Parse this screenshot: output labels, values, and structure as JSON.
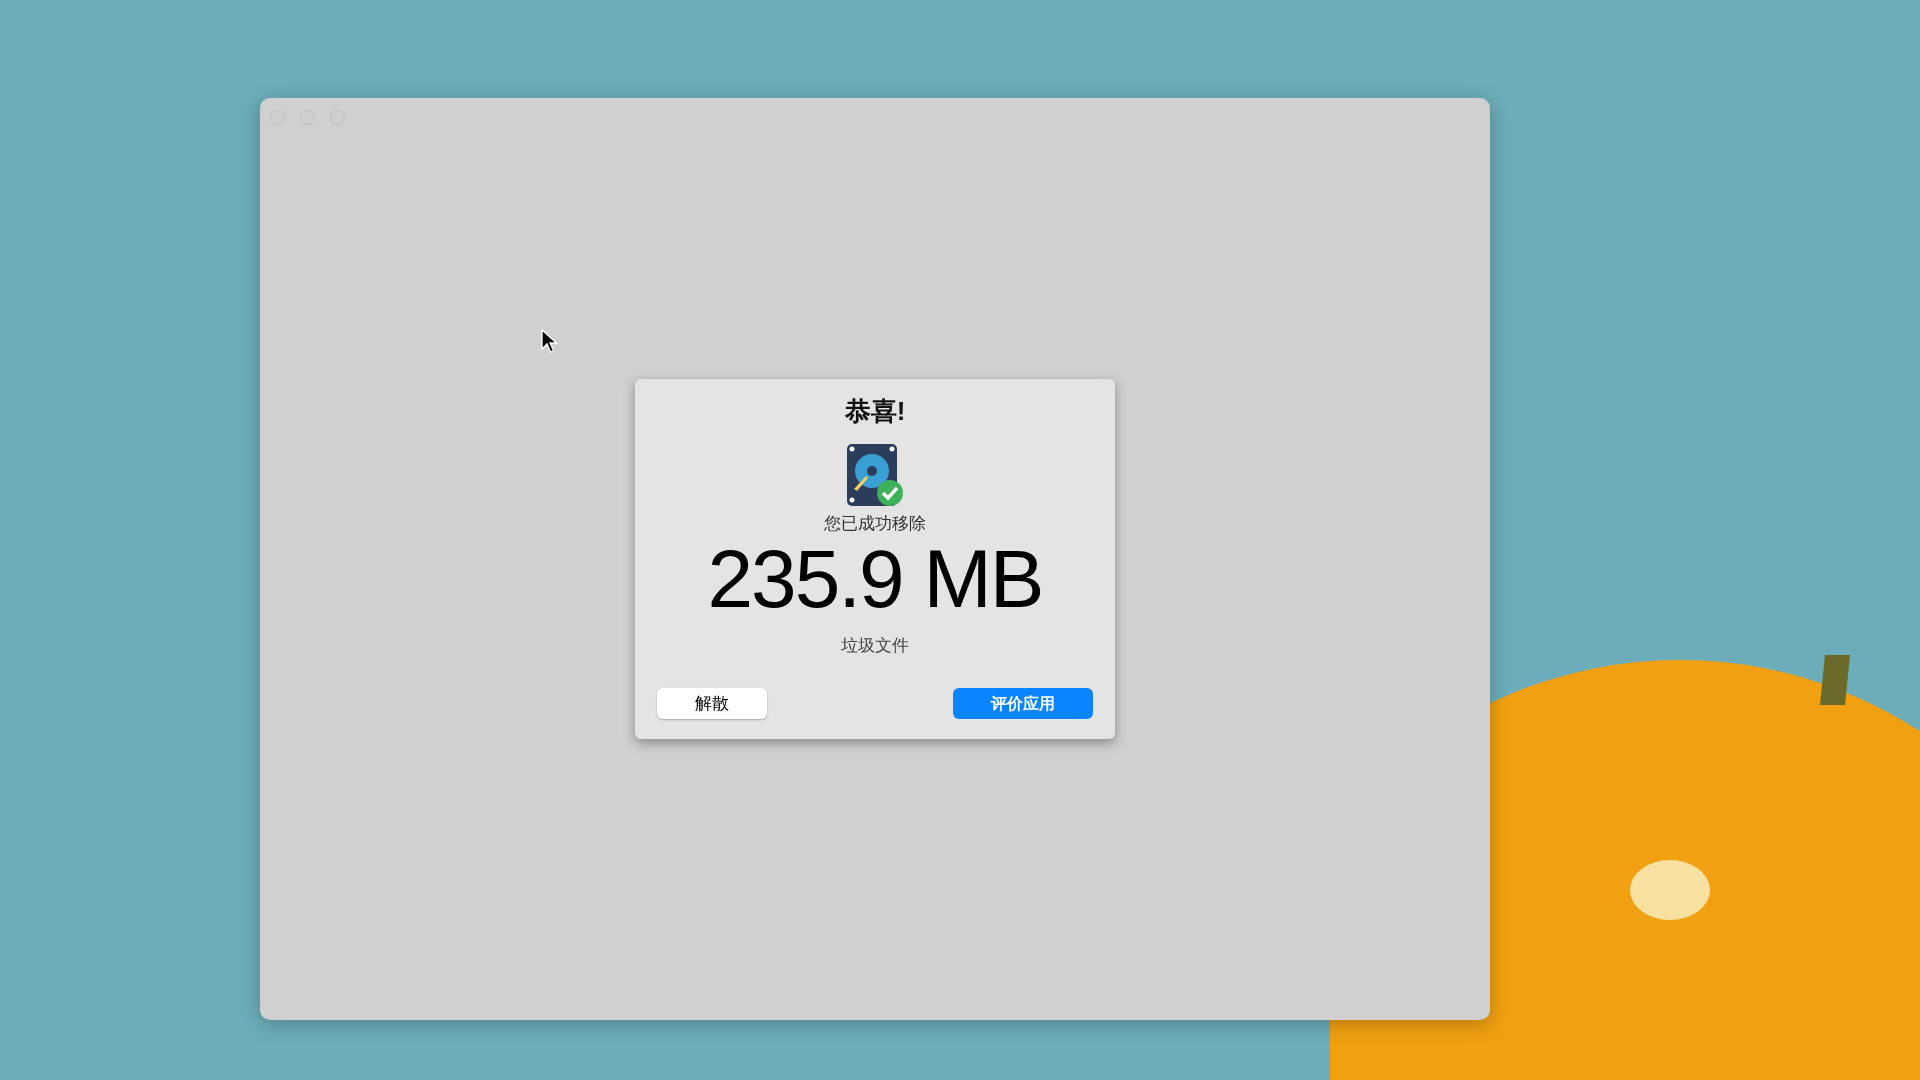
{
  "window": {
    "traffic_lights_disabled": true
  },
  "dialog": {
    "title": "恭喜!",
    "message": "您已成功移除",
    "amount": "235.9 MB",
    "caption": "垃圾文件",
    "buttons": [
      {
        "label": "解散",
        "kind": "secondary"
      },
      {
        "label": "评价应用",
        "kind": "primary"
      }
    ]
  }
}
